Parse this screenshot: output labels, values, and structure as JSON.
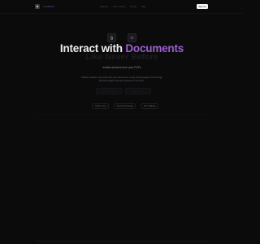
{
  "nav": {
    "brand_prefix": "Chat",
    "brand_accent": "Docs",
    "links": [
      "Features",
      "How it works",
      "Pricing",
      "FAQ"
    ],
    "sign_up": "Sign Up"
  },
  "hero": {
    "icons": [
      "document-icon",
      "chat-bubble-icon"
    ],
    "headline_white": "Interact with ",
    "headline_accent": "Documents",
    "subheadline": "Like Never Before",
    "tagline": "Instant answers from your PDFs",
    "description": "Upload, analyze, and chat with your documents using cutting-edge AI technology. Extract insights and get answers in seconds.",
    "cta_primary": "Get Started",
    "cta_secondary": "Learn More",
    "stats": [
      "1,000+ Users",
      "Secure Processing",
      "24/7 Available"
    ]
  },
  "colors": {
    "background": "#0b0b0c",
    "accent": "#9b5fd1",
    "button": "#f4f4f5"
  }
}
